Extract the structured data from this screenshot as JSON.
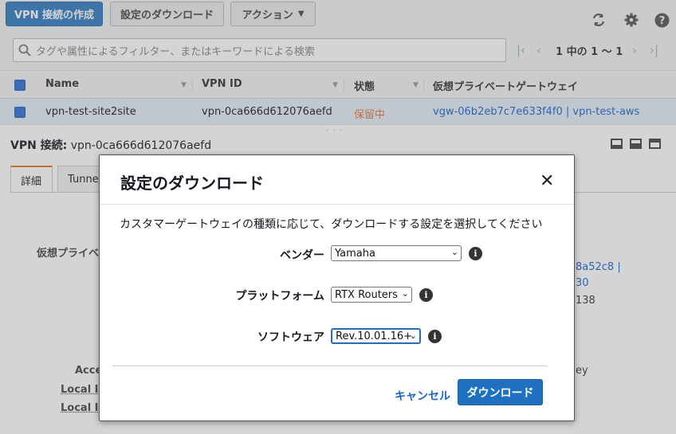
{
  "toolbar": {
    "create_vpn": "VPN 接続の作成",
    "download_config": "設定のダウンロード",
    "actions": "アクション"
  },
  "search": {
    "placeholder": "タグや属性によるフィルター、またはキーワードによる検索",
    "pager_text": "1 中の 1 〜 1"
  },
  "table": {
    "headers": [
      "Name",
      "VPN ID",
      "状態",
      "仮想プライベートゲートウェイ"
    ],
    "row": {
      "name": "vpn-test-site2site",
      "vpn_id": "vpn-0ca666d612076aefd",
      "state": "保留中",
      "vgw": "vgw-06b2eb7c7e633f4f0 | vpn-test-aws"
    }
  },
  "detail": {
    "title_prefix": "VPN 接続:",
    "title_value": "vpn-0ca666d612076aefd",
    "tabs": [
      "詳細",
      "Tunnel"
    ],
    "bg_labels": [
      "仮想プライベ",
      "Acce",
      "Local IP",
      "Local IP"
    ],
    "bg_values": [
      "8a52c8 |",
      "30",
      "138",
      "ey"
    ]
  },
  "modal": {
    "title": "設定のダウンロード",
    "description": "カスタマーゲートウェイの種類に応じて、ダウンロードする設定を選択してください",
    "vendor_label": "ベンダー",
    "vendor_value": "Yamaha",
    "platform_label": "プラットフォーム",
    "platform_value": "RTX Routers",
    "software_label": "ソフトウェア",
    "software_value": "Rev.10.01.16+",
    "cancel": "キャンセル",
    "download": "ダウンロード"
  },
  "colors": {
    "primary": "#2f7cc2",
    "link": "#1b66c9",
    "pending": "#e07941",
    "tab_accent": "#ec7211"
  }
}
